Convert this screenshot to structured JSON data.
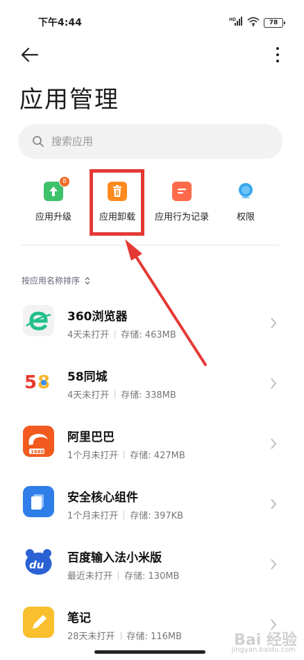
{
  "status": {
    "time": "下午4:44",
    "battery": "78",
    "network": "HD"
  },
  "header": {
    "title": "应用管理"
  },
  "search": {
    "placeholder": "搜索应用"
  },
  "tools": [
    {
      "label": "应用升级",
      "badge": "8",
      "icon": "upgrade-icon",
      "color": "#3ec16b"
    },
    {
      "label": "应用卸载",
      "icon": "trash-icon",
      "color": "#ff8a1f"
    },
    {
      "label": "应用行为记录",
      "icon": "record-icon",
      "color": "#ff6a4a"
    },
    {
      "label": "权限",
      "icon": "permission-icon",
      "color": "#37a7ef"
    }
  ],
  "sort": {
    "label": "按应用名称排序"
  },
  "apps": [
    {
      "name": "360浏览器",
      "usage": "4天未打开",
      "storage": "存储: 463MB"
    },
    {
      "name": "58同城",
      "usage": "4天未打开",
      "storage": "存储: 338MB"
    },
    {
      "name": "阿里巴巴",
      "usage": "1个月未打开",
      "storage": "存储: 427MB"
    },
    {
      "name": "安全核心组件",
      "usage": "1个月未打开",
      "storage": "存储: 397KB"
    },
    {
      "name": "百度输入法小米版",
      "usage": "最近未打开",
      "storage": "存储: 130MB"
    },
    {
      "name": "笔记",
      "usage": "28天未打开",
      "storage": "存储: 116MB"
    }
  ],
  "watermark": {
    "text": "Bai 经验",
    "sub": "jingyan.baidu.com"
  },
  "colors": {
    "highlight": "#e53935",
    "accent": "#3ec16b"
  }
}
